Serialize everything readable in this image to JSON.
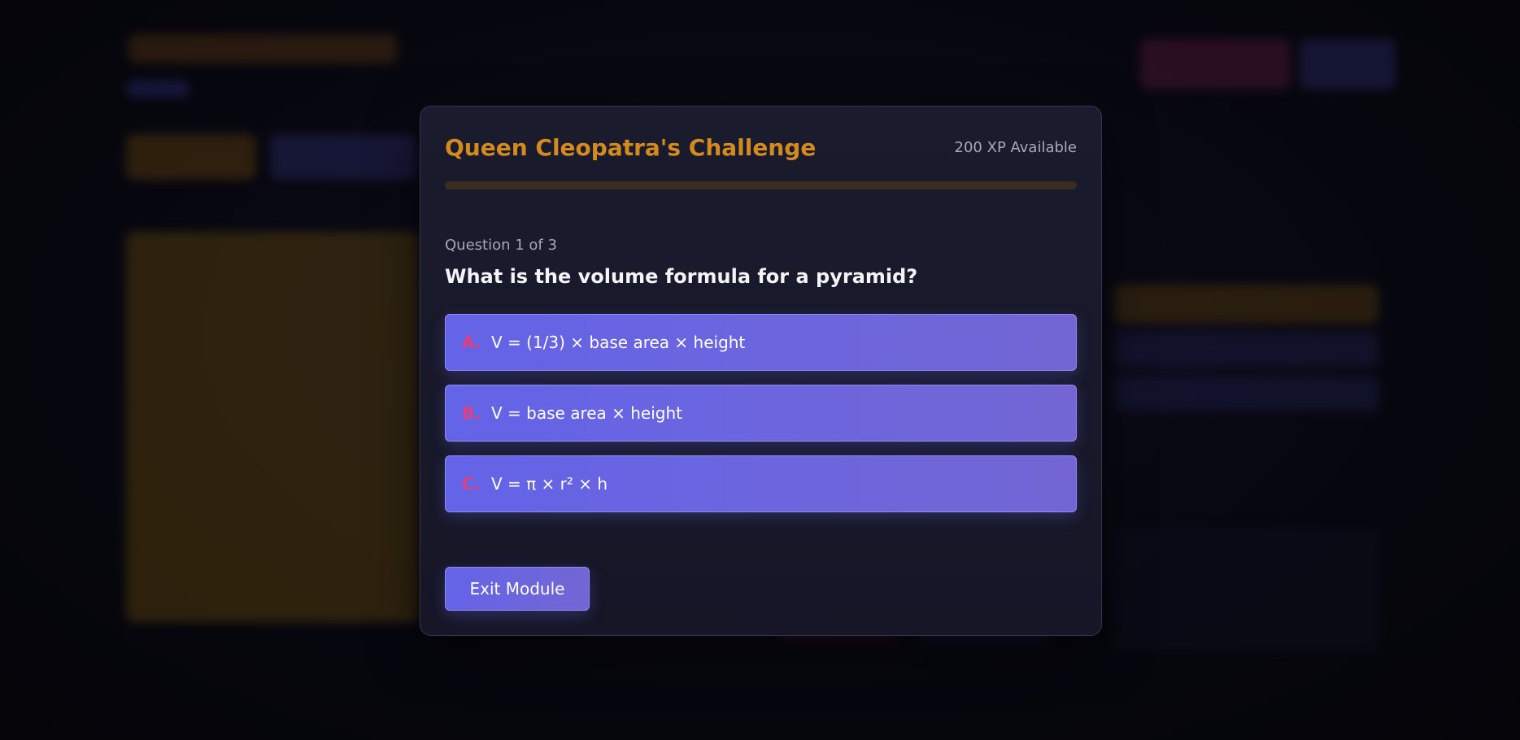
{
  "modal": {
    "title": "Queen Cleopatra's Challenge",
    "xp_label": "200 XP Available",
    "progress_fraction": 0,
    "question_counter": "Question 1 of 3",
    "question": "What is the volume formula for a pyramid?",
    "answers": [
      {
        "letter": "A.",
        "text": "V = (1/3) × base area × height"
      },
      {
        "letter": "B.",
        "text": "V = base area × height"
      },
      {
        "letter": "C.",
        "text": "V = π × r² × h"
      }
    ],
    "exit_label": "Exit Module"
  },
  "colors": {
    "accent_orange": "#d38a1f",
    "answer_purple": "#6464e8",
    "letter_pink": "#e0407e"
  }
}
